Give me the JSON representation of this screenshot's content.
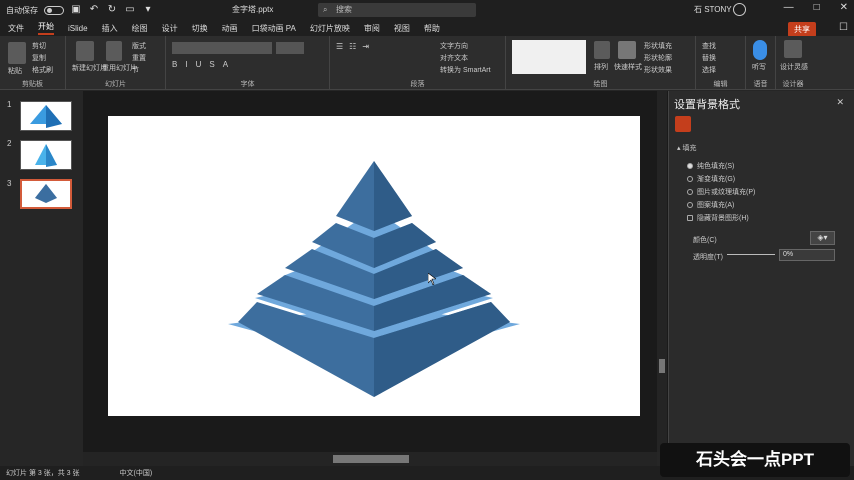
{
  "titlebar": {
    "autosave_label": "自动保存",
    "autosave_state": "关",
    "doc_title": "金字塔.pptx",
    "search_placeholder": "搜索",
    "user_name": "石 STONY",
    "win_buttons": [
      "—",
      "□",
      "✕"
    ]
  },
  "tabs": [
    "文件",
    "开始",
    "iSlide",
    "插入",
    "绘图",
    "设计",
    "切换",
    "动画",
    "口袋动画 PA",
    "幻灯片放映",
    "审阅",
    "视图",
    "帮助"
  ],
  "active_tab": "开始",
  "share_label": "共享",
  "ribbon": {
    "groups": [
      "剪贴板",
      "幻灯片",
      "字体",
      "段落",
      "绘图",
      "编辑",
      "语音",
      "设计器"
    ],
    "clipboard": {
      "paste": "粘贴",
      "cut": "剪切",
      "copy": "复制",
      "format_painter": "格式刷"
    },
    "slides": {
      "new_slide": "新建幻灯片",
      "reuse": "重用幻灯片",
      "layout": "版式",
      "reset": "重置",
      "section": "节"
    },
    "paragraph": {
      "text_direction": "文字方向",
      "align_text": "对齐文本",
      "smartart": "转换为 SmartArt"
    },
    "drawing": {
      "arrange": "排列",
      "quick_styles": "快速样式",
      "shape_fill": "形状填充",
      "shape_outline": "形状轮廓",
      "shape_effects": "形状效果"
    },
    "editing": {
      "find": "查找",
      "replace": "替换",
      "select": "选择"
    },
    "voice": {
      "dictate": "听写"
    },
    "designer": {
      "design_ideas": "设计灵感"
    }
  },
  "slides_panel": {
    "numbers": [
      "1",
      "2",
      "3"
    ],
    "selected": 3
  },
  "format_pane": {
    "title": "设置背景格式",
    "close": "✕",
    "section": "填充",
    "options": [
      "纯色填充(S)",
      "渐变填充(G)",
      "图片或纹理填充(P)",
      "图案填充(A)",
      "隐藏背景图形(H)"
    ],
    "selected_option": 0,
    "color_label": "颜色(C)",
    "transparency_label": "透明度(T)",
    "transparency_value": "0%"
  },
  "statusbar": {
    "slide_info": "幻灯片 第 3 张，共 3 张",
    "language": "中文(中国)"
  },
  "watermark": "石头会一点PPT",
  "colors": {
    "accent": "#c43e1c",
    "pyramid_dark": "#3b6ea0",
    "pyramid_light": "#6fa8dc"
  }
}
